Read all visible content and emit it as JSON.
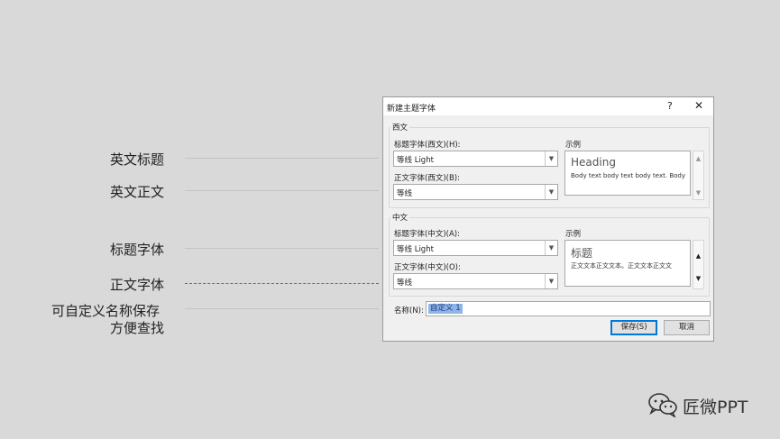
{
  "annotations": {
    "en_heading": "英文标题",
    "en_body": "英文正文",
    "heading_font": "标题字体",
    "body_font": "正文字体",
    "name_line1": "可自定义名称保存",
    "name_line2": "方便查找"
  },
  "dialog": {
    "title": "新建主题字体",
    "help": "?",
    "close": "✕",
    "western": {
      "group_label": "西文",
      "heading_label": "标题字体(西文)(H):",
      "heading_value": "等线 Light",
      "body_label": "正文字体(西文)(B):",
      "body_value": "等线",
      "sample_label": "示例",
      "sample_heading": "Heading",
      "sample_body": "Body text body text body text. Body"
    },
    "eastasian": {
      "group_label": "中文",
      "heading_label": "标题字体(中文)(A):",
      "heading_value": "等线 Light",
      "body_label": "正文字体(中文)(O):",
      "body_value": "等线",
      "sample_label": "示例",
      "sample_heading": "标题",
      "sample_body": "正文文本正文文本。正文文本正文文"
    },
    "name_label": "名称(N):",
    "name_value": "自定义 1",
    "save_label": "保存(S)",
    "cancel_label": "取消"
  },
  "logo": {
    "text": "匠微PPT",
    "icon": "wechat-icon"
  }
}
